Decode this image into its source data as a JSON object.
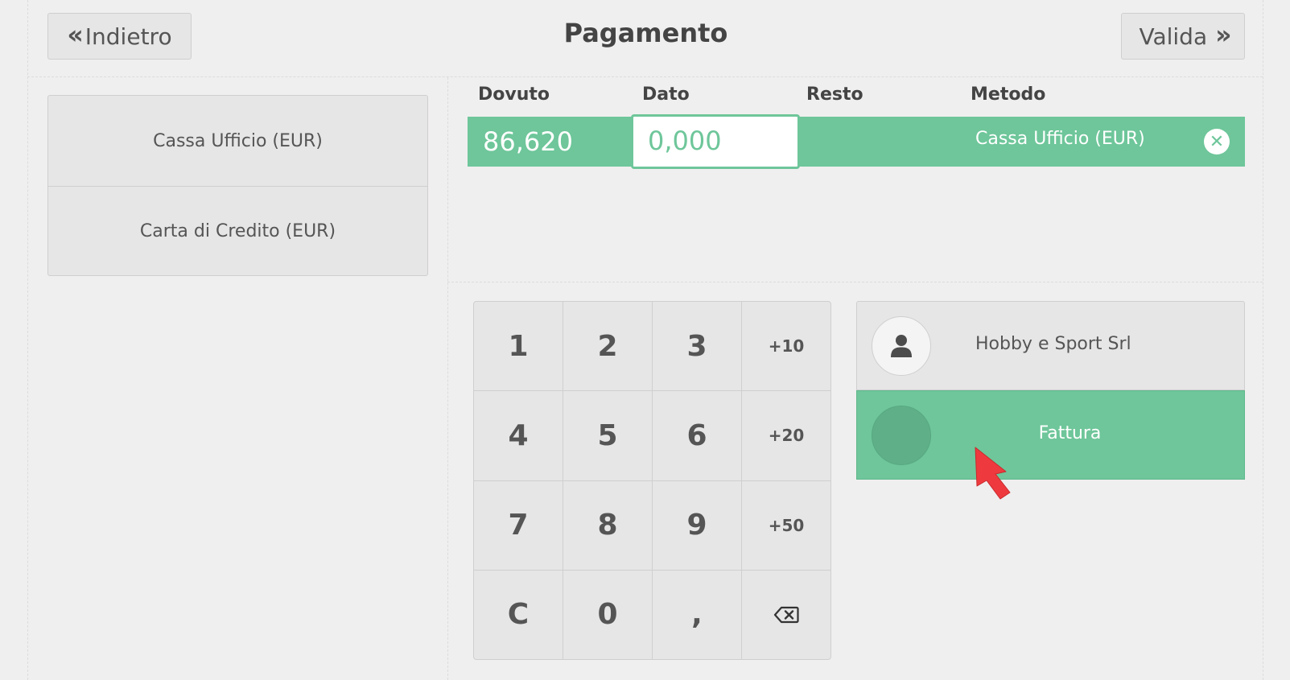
{
  "header": {
    "back_label": "Indietro",
    "title": "Pagamento",
    "validate_label": "Valida"
  },
  "payment_methods": [
    {
      "label": "Cassa Ufficio (EUR)"
    },
    {
      "label": "Carta di Credito (EUR)"
    }
  ],
  "paymentlines": {
    "columns": [
      "Dovuto",
      "Dato",
      "Resto",
      "Metodo"
    ],
    "line": {
      "due": "86,620",
      "given": "0,000",
      "change": "",
      "method": "Cassa Ufficio (EUR)"
    }
  },
  "numpad": {
    "keys": [
      "1",
      "2",
      "3",
      "+10",
      "4",
      "5",
      "6",
      "+20",
      "7",
      "8",
      "9",
      "+50",
      "C",
      "0",
      ",",
      "backspace"
    ]
  },
  "customer": {
    "name": "Hobby e Sport Srl",
    "icon": "user-icon"
  },
  "invoice": {
    "label": "Fattura"
  },
  "colors": {
    "accent": "#6ec69a",
    "background": "#f0efef",
    "button": "#e6e6e6"
  }
}
